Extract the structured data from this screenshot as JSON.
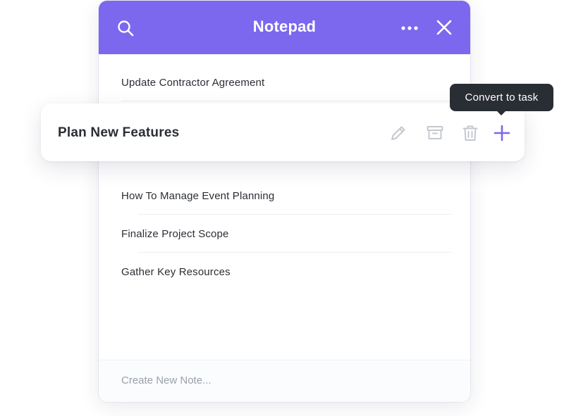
{
  "header": {
    "title": "Notepad"
  },
  "notes": [
    "Update Contractor Agreement",
    "How To Manage Event Planning",
    "Finalize Project Scope",
    "Gather Key Resources"
  ],
  "active_note": {
    "title": "Plan New Features",
    "actions": [
      "pencil-icon",
      "archive-icon",
      "trash-icon",
      "plus-icon"
    ]
  },
  "tooltip": {
    "text": "Convert to task"
  },
  "footer": {
    "placeholder": "Create New Note..."
  },
  "colors": {
    "accent": "#7b68ee",
    "text": "#2a2e34",
    "muted_icon": "#c4c8cf",
    "tooltip_bg": "#292d34"
  },
  "icons": {
    "search": "search-icon",
    "more": "more-icon",
    "close": "close-icon"
  }
}
